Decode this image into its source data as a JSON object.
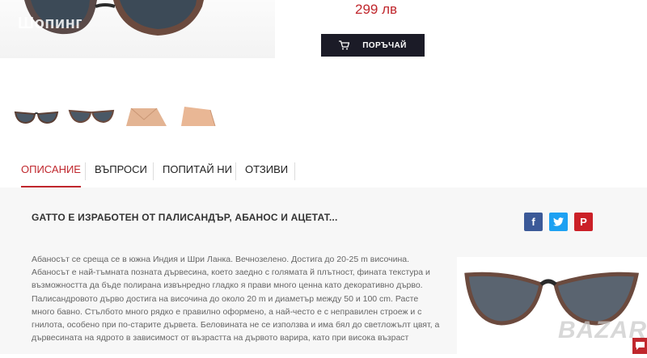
{
  "header": {
    "watermark": "Шопинг"
  },
  "product": {
    "price": "299 лв",
    "order_label": "ПОРЪЧАЙ",
    "thumbnails": [
      "sunglasses-front",
      "sunglasses-angle",
      "case-closed",
      "case-open"
    ]
  },
  "tabs": [
    {
      "label": "ОПИСАНИЕ",
      "active": true
    },
    {
      "label": "ВЪПРОСИ",
      "active": false
    },
    {
      "label": "ПОПИТАЙ НИ",
      "active": false
    },
    {
      "label": "ОТЗИВИ",
      "active": false
    }
  ],
  "description": {
    "title": "GATTO Е ИЗРАБОТЕН ОТ ПАЛИСАНДЪР, АБАНОС И АЦЕТАТ...",
    "paragraph1": "Абаносът се среща се в южна Индия и Шри Ланка. Вечнозелено. Достига до 20-25 m височина. Абаносът е най-тъмната позната дървесина, което заедно с голямата й плътност, фината текстура и възможността да бъде полирана извънредно гладко я прави много ценна като декоративно дърво.",
    "paragraph2": "Палисандровото дърво достига на височина до около 20 m и диаметър между 50 и 100 cm. Расте много бавно. Стълбото много рядко е правилно оформено, а най-често е с неправилен строеж и с гнилота, особено при по-старите дървета. Беловината не се използва и има бял до светложълт цвят, а дървесината на ядрото в зависимост от възрастта на дървото варира, като при висока възраст"
  },
  "share": {
    "facebook": "f",
    "twitter": "t",
    "pinterest": "P"
  },
  "watermark_bottom": "BAZAR",
  "colors": {
    "accent": "#c0272d",
    "button": "#1b1b27",
    "facebook": "#3b5998",
    "twitter": "#1da1f2",
    "pinterest": "#cb2027"
  }
}
